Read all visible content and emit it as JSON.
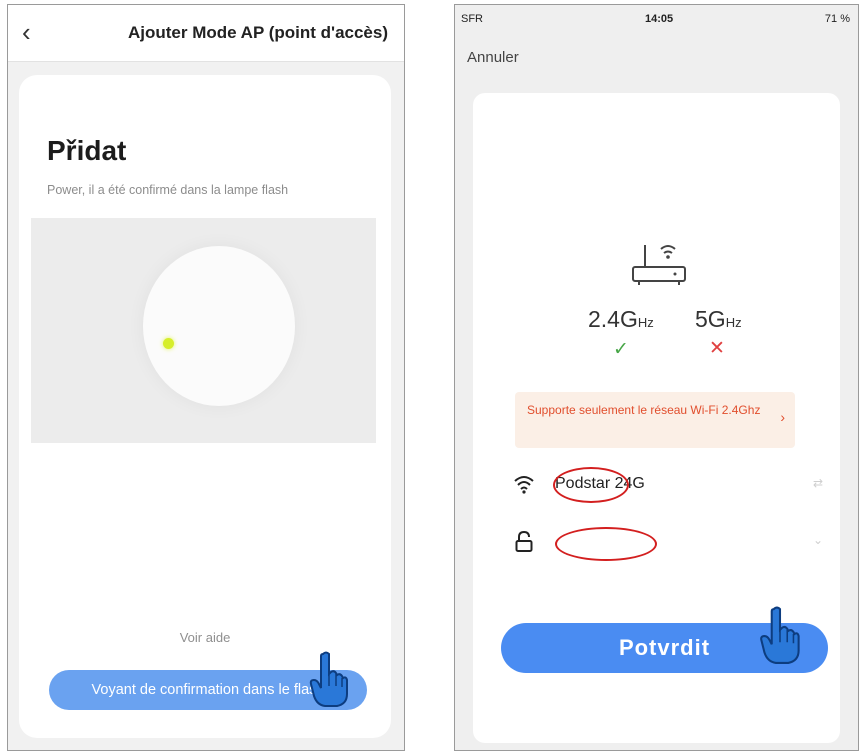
{
  "left": {
    "header": {
      "back_icon": "chevron-left-icon",
      "title": "Ajouter  Mode AP (point d'accès)"
    },
    "card": {
      "heading": "Přidat",
      "description": "Power, il a été confirmé dans la lampe flash",
      "help_link": "Voir aide",
      "confirm_button": "Voyant de confirmation dans le flash"
    }
  },
  "right": {
    "status_bar": {
      "carrier": "SFR",
      "time": "14:05",
      "battery": "71 %"
    },
    "cancel": "Annuler",
    "bands": {
      "band_24": {
        "value": "2.4G",
        "unit": "Hz",
        "supported": true
      },
      "band_5": {
        "value": "5G",
        "unit": "Hz",
        "supported": false
      }
    },
    "notice": "Supporte seulement le réseau Wi-Fi 2.4Ghz",
    "wifi": {
      "name": "Podstar 24G"
    },
    "confirm_button": "Potvrdit"
  },
  "colors": {
    "button_blue": "#4a8cf2",
    "annotation_red": "#d31f1f",
    "notice_orange": "#e14e2d",
    "lamp_dot": "#d6ee2a"
  }
}
